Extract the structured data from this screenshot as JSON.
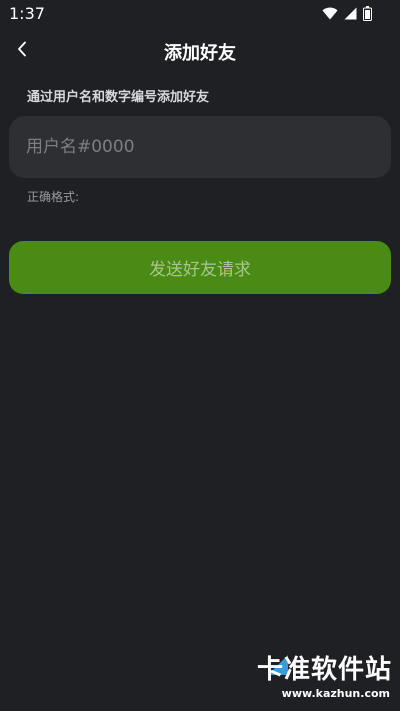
{
  "status_bar": {
    "time": "1:37",
    "icons": [
      "wifi-icon",
      "cellular-signal-icon",
      "battery-icon"
    ]
  },
  "header": {
    "title": "添加好友",
    "back_icon": "chevron-left-icon"
  },
  "form": {
    "instruction": "通过用户名和数字编号添加好友",
    "input_value": "",
    "input_placeholder": "用户名#0000",
    "format_label": "正确格式:"
  },
  "actions": {
    "send_label": "发送好友请求"
  },
  "watermark": {
    "title": "卡准软件站",
    "url": "www.kazhun.com"
  },
  "colors": {
    "background": "#1f2023",
    "input_background": "#2e2f33",
    "button_green": "#4a8b15",
    "button_text": "#a8c58f"
  }
}
